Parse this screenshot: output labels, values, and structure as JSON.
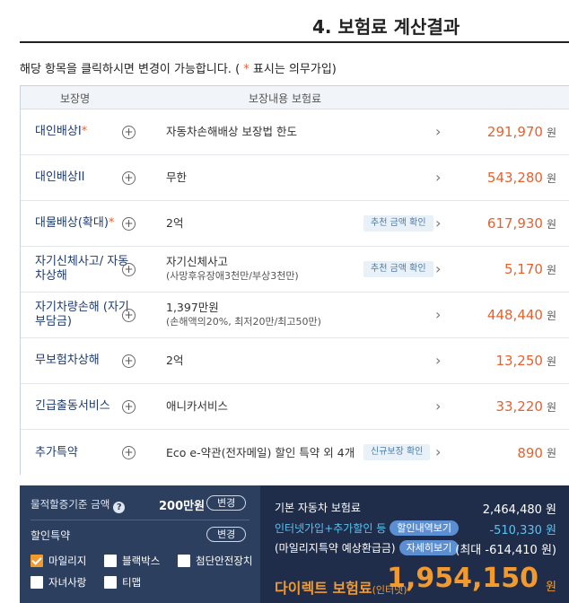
{
  "page": {
    "title": "4. 보험료 계산결과",
    "notice_prefix": "해당 항목을 클릭하시면 변경이 가능합니다. (",
    "notice_star": " * ",
    "notice_suffix": "표시는 의무가입)"
  },
  "table": {
    "headers": [
      "보장명",
      "보장내용  보험료"
    ],
    "rows": [
      {
        "name": "대인배상I",
        "required": "*",
        "content": "자동차손해배상 보장법 한도",
        "sub": "",
        "badge": "",
        "amount": "291,970",
        "unit": "원"
      },
      {
        "name": "대인배상II",
        "required": "",
        "content": "무한",
        "sub": "",
        "badge": "",
        "amount": "543,280",
        "unit": "원"
      },
      {
        "name": "대물배상(확대)",
        "required": "*",
        "content": "2억",
        "sub": "",
        "badge": "추천 금액 확인",
        "amount": "617,930",
        "unit": "원"
      },
      {
        "name": "자기신체사고/ 자동차상해",
        "required": "",
        "content": "자기신체사고",
        "sub": "(사망후유장애3천만/부상3천만)",
        "badge": "추천 금액 확인",
        "amount": "5,170",
        "unit": "원"
      },
      {
        "name": "자기차량손해 (자기부담금)",
        "required": "",
        "content": "1,397만원",
        "sub": "(손해액의20%, 최저20만/최고50만)",
        "badge": "",
        "amount": "448,440",
        "unit": "원"
      },
      {
        "name": "무보험차상해",
        "required": "",
        "content": "2억",
        "sub": "",
        "badge": "",
        "amount": "13,250",
        "unit": "원"
      },
      {
        "name": "긴급출동서비스",
        "required": "",
        "content": "애니카서비스",
        "sub": "",
        "badge": "",
        "amount": "33,220",
        "unit": "원"
      },
      {
        "name": "추가특약",
        "required": "",
        "content": "Eco e-약관(전자메일) 할인 특약 외 4개",
        "sub": "",
        "badge": "신규보장 확인",
        "amount": "890",
        "unit": "원"
      }
    ]
  },
  "left_panel": {
    "property_label": "물적할증기준 금액",
    "property_value": "200만원",
    "change_label": "변경",
    "discount_label": "할인특약",
    "discount_change_label": "변경",
    "options": [
      {
        "label": "마일리지",
        "checked": true
      },
      {
        "label": "블랙박스",
        "checked": false
      },
      {
        "label": "첨단안전장치",
        "checked": false
      },
      {
        "label": "자녀사랑",
        "checked": false
      },
      {
        "label": "티맵",
        "checked": false
      }
    ]
  },
  "right_panel": {
    "base_label": "기본 자동차 보험료",
    "base_value": "2,464,480 원",
    "discount_label": "인터넷가입+추가할인 등",
    "discount_pill": "할인내역보기",
    "discount_value": "-510,330 원",
    "mileage_label": "(마일리지특약 예상환급금)",
    "mileage_pill": "자세히보기",
    "mileage_value": "(최대 -614,410 원)",
    "total_label": "다이렉트 보험료",
    "total_suffix": "(인터넷)",
    "total_value": "1,954,150",
    "total_unit": "원"
  },
  "colors": {
    "accent_orange": "#e8612c",
    "total_orange": "#f39a2e",
    "navy_dark": "#1f2d4a",
    "navy": "#2c3f5f",
    "cyan": "#59c4f2"
  }
}
